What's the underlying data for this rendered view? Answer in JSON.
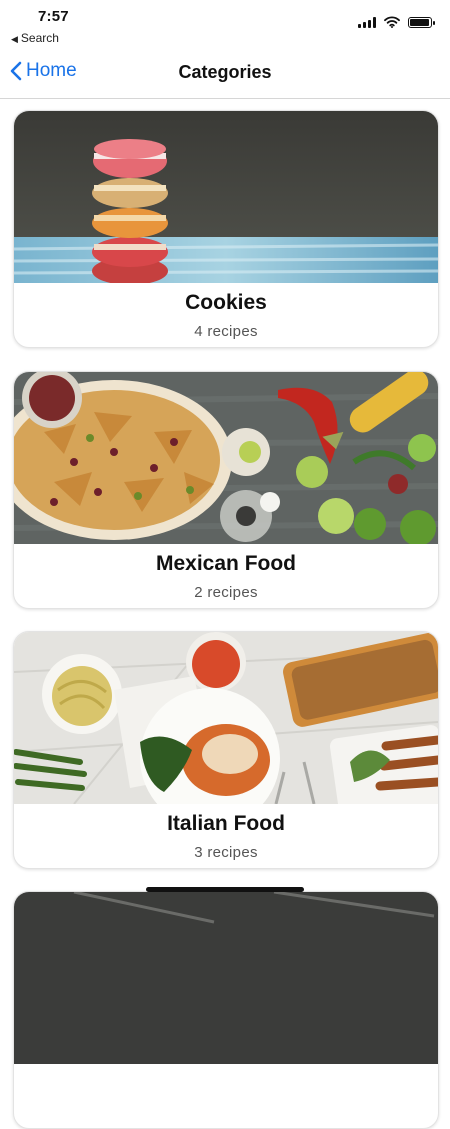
{
  "status_bar": {
    "time": "7:57",
    "back_app_label": "Search"
  },
  "nav": {
    "back_label": "Home",
    "title": "Categories"
  },
  "categories": [
    {
      "title": "Cookies",
      "count_label": "4 recipes"
    },
    {
      "title": "Mexican Food",
      "count_label": "2 recipes"
    },
    {
      "title": "Italian Food",
      "count_label": "3 recipes"
    }
  ],
  "colors": {
    "accent": "#1a73e8",
    "background": "#ffffff",
    "card_border": "#e3e3e3"
  }
}
